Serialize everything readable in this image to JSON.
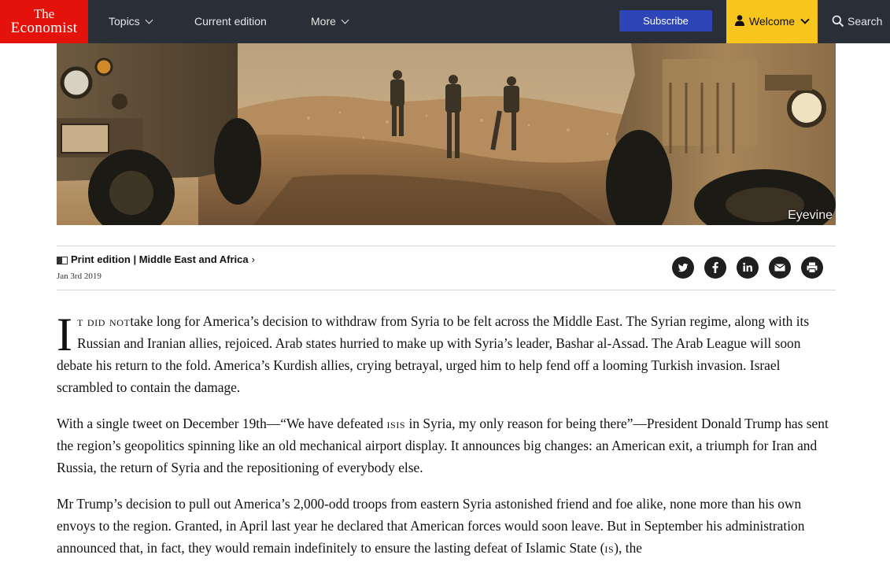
{
  "nav": {
    "logo_line1": "The",
    "logo_line2": "Economist",
    "topics": "Topics",
    "current_edition": "Current edition",
    "more": "More",
    "subscribe": "Subscribe",
    "welcome": "Welcome",
    "search": "Search"
  },
  "hero": {
    "credit": "Eyevine"
  },
  "meta": {
    "section": "Print edition | Middle East and Africa",
    "date": "Jan 3rd 2019",
    "share_icons": [
      "twitter-icon",
      "facebook-icon",
      "linkedin-icon",
      "mail-icon",
      "print-icon"
    ]
  },
  "article": {
    "dropcap": "I",
    "p1_smallcaps": "t did not",
    "p1_rest": "take long for America’s decision to withdraw from Syria to be felt across the Middle East. The Syrian regime, along with its Russian and Iranian allies, rejoiced. Arab states hurried to make up with Syria’s leader, Bashar al-Assad. The Arab League will soon debate his return to the fold. America’s Kurdish allies, crying betrayal, urged him to help fend off a looming Turkish invasion. Israel scrambled to contain the damage.",
    "p2_a": "With a single tweet on December 19th—“We have defeated ",
    "p2_isis": "isis",
    "p2_b": " in Syria, my only reason for being there”—President Donald Trump has sent the region’s geopolitics spinning like an old mechanical airport display. It announces big changes: an American exit, a triumph for Iran and Russia, the return of Syria and the repositioning of everybody else.",
    "p3_a": "Mr Trump’s decision to pull out America’s 2,000-odd troops from eastern Syria astonished friend and foe alike, none more than his own envoys to the region. Granted, in April last year he declared that American forces would soon leave. But in September his administration announced that, in fact, they would remain indefinitely to ensure the lasting defeat of Islamic State (",
    "p3_is": "is",
    "p3_b": "), the"
  },
  "colors": {
    "brand_red": "#e3120b",
    "nav_bg": "#2a2e36",
    "subscribe_blue": "#2e45b8",
    "welcome_yellow": "#f8c51c"
  }
}
